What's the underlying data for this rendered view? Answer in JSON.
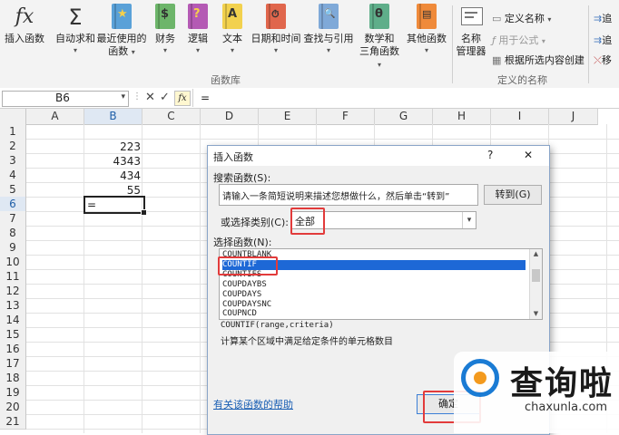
{
  "ribbon": {
    "insert_function": "插入函数",
    "autosum": "自动求和",
    "recent_line1": "最近使用的",
    "recent_line2": "函数",
    "financial": "财务",
    "logical": "逻辑",
    "text": "文本",
    "datetime": "日期和时间",
    "lookup": "查找与引用",
    "math_line1": "数学和",
    "math_line2": "三角函数",
    "more": "其他函数",
    "name_mgr_line1": "名称",
    "name_mgr_line2": "管理器",
    "define_name": "定义名称",
    "use_in_formula": "用于公式",
    "create_from_sel": "根据所选内容创建",
    "group_library": "函数库",
    "group_names": "定义的名称",
    "fx_glyph": "fx",
    "sigma_glyph": "Σ",
    "book_glyphs": [
      "★",
      "$",
      "?",
      "A",
      "⏱",
      "🔍",
      "θ",
      "▤"
    ],
    "trace_items": [
      "追",
      "追",
      "移"
    ]
  },
  "formula_bar": {
    "name_box": "B6",
    "formula": "=",
    "cancel": "✕",
    "enter": "✓",
    "fx": "fx"
  },
  "sheet": {
    "columns": [
      "A",
      "B",
      "C",
      "D",
      "E",
      "F",
      "G",
      "H",
      "I",
      "J"
    ],
    "rows": [
      "1",
      "2",
      "3",
      "4",
      "5",
      "6",
      "7",
      "8",
      "9",
      "10",
      "11",
      "12",
      "13",
      "14",
      "15",
      "16",
      "17",
      "18",
      "19",
      "20",
      "21"
    ],
    "b2": "223",
    "b3": "4343",
    "b4": "434",
    "b5": "55",
    "b6": "="
  },
  "dialog": {
    "title": "插入函数",
    "help_btn": "?",
    "close_btn": "✕",
    "search_label": "搜索函数(S):",
    "search_value": "请输入一条简短说明来描述您想做什么，然后单击“转到”",
    "go_button": "转到(G)",
    "category_label": "或选择类别(C):",
    "category_value": "全部",
    "select_label": "选择函数(N):",
    "functions": [
      "COUNTBLANK",
      "COUNTIF",
      "COUNTIFS",
      "COUPDAYBS",
      "COUPDAYS",
      "COUPDAYSNC",
      "COUPNCD"
    ],
    "selected_function": "COUNTIF",
    "syntax": "COUNTIF(range,criteria)",
    "description": "计算某个区域中满足给定条件的单元格数目",
    "help_link": "有关该函数的帮助",
    "ok_button": "确定"
  },
  "watermark": {
    "brand": "查询啦",
    "url": "chaxunla.com"
  },
  "colors": {
    "accent_blue": "#1d68d6",
    "annotation_red": "#e23b3b",
    "watermark_blue": "#1a7bd4",
    "watermark_orange": "#f39a1e"
  }
}
